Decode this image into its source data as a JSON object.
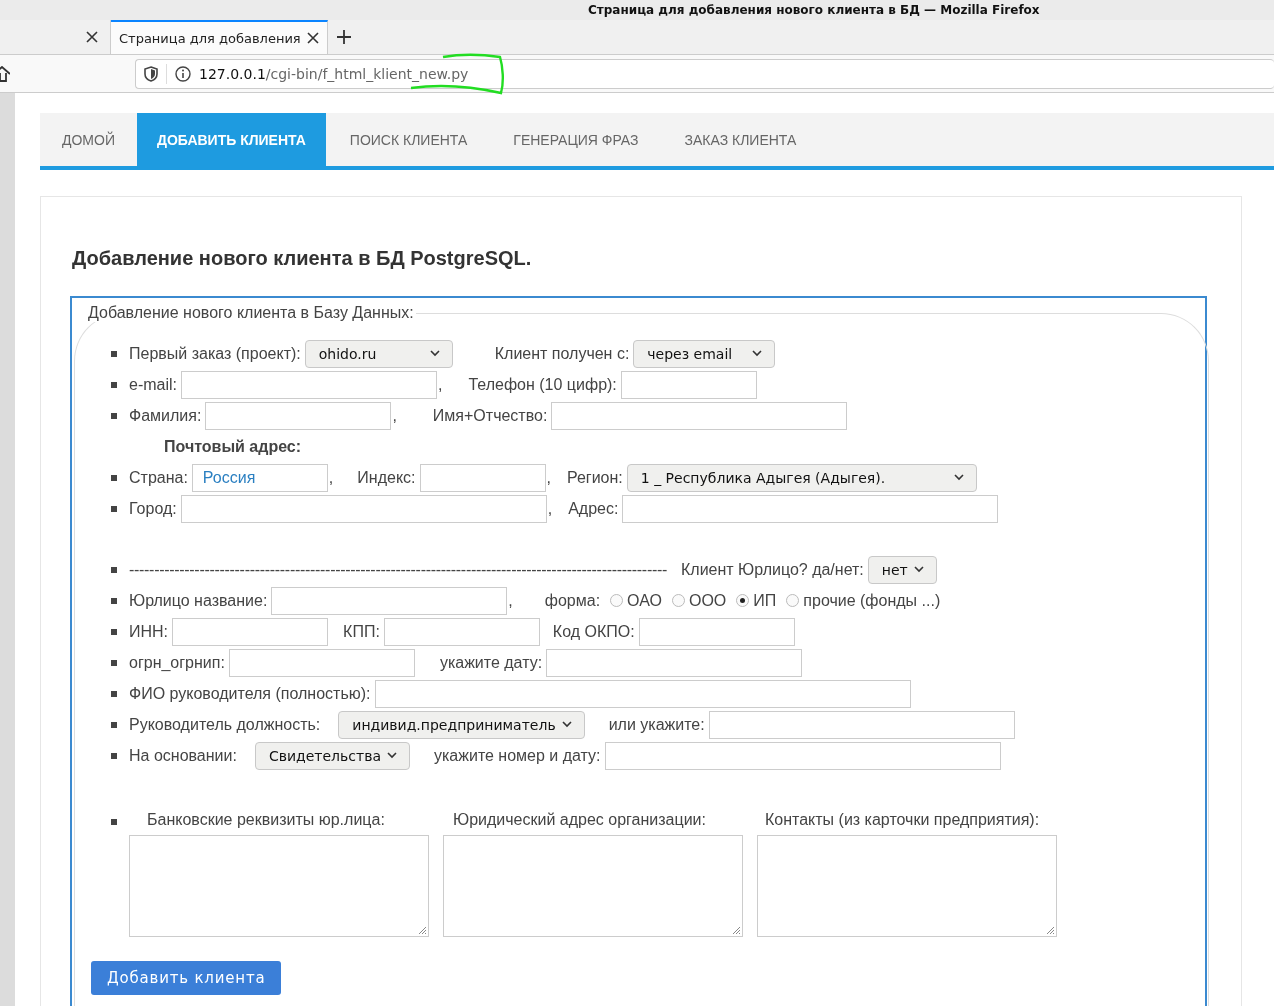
{
  "window": {
    "title": "Страница для добавления нового клиента в БД — Mozilla Firefox"
  },
  "tabs": [
    {
      "selected": false
    },
    {
      "label": "Страница для добавления",
      "selected": true
    }
  ],
  "address_bar": {
    "host": "127.0.0.1",
    "path": "/cgi-bin/f_html_klient_new.py"
  },
  "nav": [
    {
      "label": "ДОМОЙ",
      "selected": false
    },
    {
      "label": "ДОБАВИТЬ КЛИЕНТА",
      "selected": true
    },
    {
      "label": "ПОИСК КЛИЕНТА",
      "selected": false
    },
    {
      "label": "ГЕНЕРАЦИЯ ФРАЗ",
      "selected": false
    },
    {
      "label": "ЗАКАЗ КЛИЕНТА",
      "selected": false
    }
  ],
  "heading": "Добавление нового клиента в БД PostgreSQL.",
  "form": {
    "legend": "Добавление нового клиента в Базу Данных:",
    "rows": [
      {
        "kind": "item",
        "items": [
          {
            "kind": "label",
            "text": "Первый заказ (проект):"
          },
          {
            "kind": "select",
            "value": "ohido.ru"
          },
          {
            "kind": "label",
            "text": "Клиент получен с:"
          },
          {
            "kind": "select",
            "value": "через email"
          }
        ]
      },
      {
        "kind": "item",
        "items": [
          {
            "kind": "label",
            "text": "e-mail:"
          },
          {
            "kind": "input"
          },
          {
            "kind": "comma",
            "text": ","
          },
          {
            "kind": "label",
            "text": "Телефон (10 цифр):"
          },
          {
            "kind": "input"
          }
        ]
      },
      {
        "kind": "item",
        "items": [
          {
            "kind": "label",
            "text": "Фамилия:"
          },
          {
            "kind": "input"
          },
          {
            "kind": "comma",
            "text": ","
          },
          {
            "kind": "label",
            "text": "Имя+Отчество:"
          },
          {
            "kind": "input"
          }
        ]
      },
      {
        "kind": "heading",
        "items": [
          {
            "kind": "label",
            "text": "Почтовый адрес:"
          }
        ]
      },
      {
        "kind": "item",
        "items": [
          {
            "kind": "label",
            "text": "Страна:"
          },
          {
            "kind": "input",
            "value": "Россия"
          },
          {
            "kind": "comma",
            "text": ","
          },
          {
            "kind": "label",
            "text": "Индекс:"
          },
          {
            "kind": "input"
          },
          {
            "kind": "comma",
            "text": ","
          },
          {
            "kind": "label",
            "text": "Регион:"
          },
          {
            "kind": "select",
            "value": "1 _ Республика Адыгея (Адыгея)."
          }
        ]
      },
      {
        "kind": "item",
        "items": [
          {
            "kind": "label",
            "text": "Город:"
          },
          {
            "kind": "input"
          },
          {
            "kind": "comma",
            "text": ","
          },
          {
            "kind": "label",
            "text": "Адрес:"
          },
          {
            "kind": "input"
          }
        ]
      },
      {
        "kind": "item",
        "items": [
          {
            "kind": "divider",
            "text": "-----------------------------------------------------------------------------------------------------------"
          },
          {
            "kind": "label",
            "text": "Клиент Юрлицо? да/нет:"
          },
          {
            "kind": "select",
            "value": "нет"
          }
        ]
      },
      {
        "kind": "item",
        "items": [
          {
            "kind": "label",
            "text": "Юрлицо название:"
          },
          {
            "kind": "input"
          },
          {
            "kind": "comma",
            "text": ","
          },
          {
            "kind": "label",
            "text": "форма:"
          },
          {
            "kind": "radio",
            "text": "ОАО",
            "selected": false
          },
          {
            "kind": "radio",
            "text": "ООО",
            "selected": false
          },
          {
            "kind": "radio",
            "text": "ИП",
            "selected": true
          },
          {
            "kind": "radio",
            "text": "прочие (фонды ...)",
            "selected": false
          }
        ]
      },
      {
        "kind": "item",
        "items": [
          {
            "kind": "label",
            "text": "ИНН:"
          },
          {
            "kind": "input"
          },
          {
            "kind": "label",
            "text": "КПП:"
          },
          {
            "kind": "input"
          },
          {
            "kind": "label",
            "text": "Код ОКПО:"
          },
          {
            "kind": "input"
          }
        ]
      },
      {
        "kind": "item",
        "items": [
          {
            "kind": "label",
            "text": "огрн_огрнип:"
          },
          {
            "kind": "input"
          },
          {
            "kind": "label",
            "text": "укажите дату:"
          },
          {
            "kind": "input"
          }
        ]
      },
      {
        "kind": "item",
        "items": [
          {
            "kind": "label",
            "text": "ФИО руководителя (полностью):"
          },
          {
            "kind": "input"
          }
        ]
      },
      {
        "kind": "item",
        "items": [
          {
            "kind": "label",
            "text": "Руководитель должность:"
          },
          {
            "kind": "select",
            "value": "индивид.предприниматель"
          },
          {
            "kind": "label",
            "text": "или укажите:"
          },
          {
            "kind": "input"
          }
        ]
      },
      {
        "kind": "item",
        "items": [
          {
            "kind": "label",
            "text": "На основании:"
          },
          {
            "kind": "select",
            "value": "Свидетельства"
          },
          {
            "kind": "label",
            "text": "укажите номер и дату:"
          },
          {
            "kind": "input"
          }
        ]
      },
      {
        "kind": "columns",
        "items": [
          {
            "kind": "textarea",
            "text": "Банковские реквизиты юр.лица:"
          },
          {
            "kind": "textarea",
            "text": "Юридический адрес организации:"
          },
          {
            "kind": "textarea",
            "text": "Контакты (из карточки предприятия):"
          }
        ]
      }
    ],
    "submit": "Добавить клиента"
  }
}
